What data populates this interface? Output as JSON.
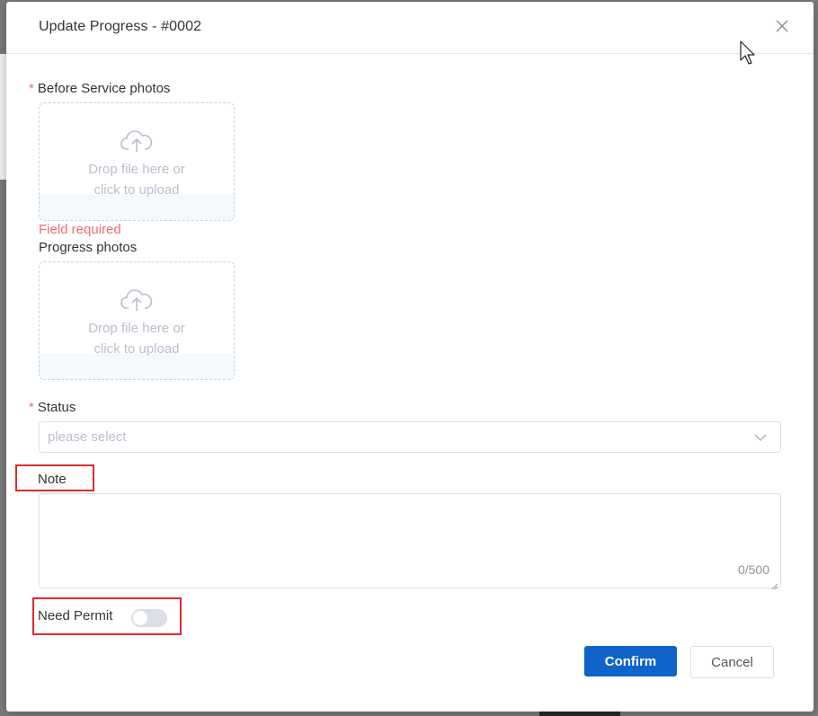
{
  "dialog": {
    "title": "Update Progress - #0002"
  },
  "form": {
    "required_marker": "*",
    "before_photos": {
      "label": "Before Service photos",
      "hint_line1": "Drop file here or",
      "hint_line2": "click to upload",
      "error": "Field required"
    },
    "progress_photos": {
      "label": "Progress photos",
      "hint_line1": "Drop file here or",
      "hint_line2": "click to upload"
    },
    "status": {
      "label": "Status",
      "placeholder": "please select"
    },
    "note": {
      "label": "Note",
      "counter": "0/500"
    },
    "need_permit": {
      "label": "Need Permit",
      "enabled": false
    }
  },
  "footer": {
    "confirm_label": "Confirm",
    "cancel_label": "Cancel"
  },
  "colors": {
    "primary": "#1063c8",
    "error": "#f56c6c",
    "highlight": "#e0282e"
  }
}
